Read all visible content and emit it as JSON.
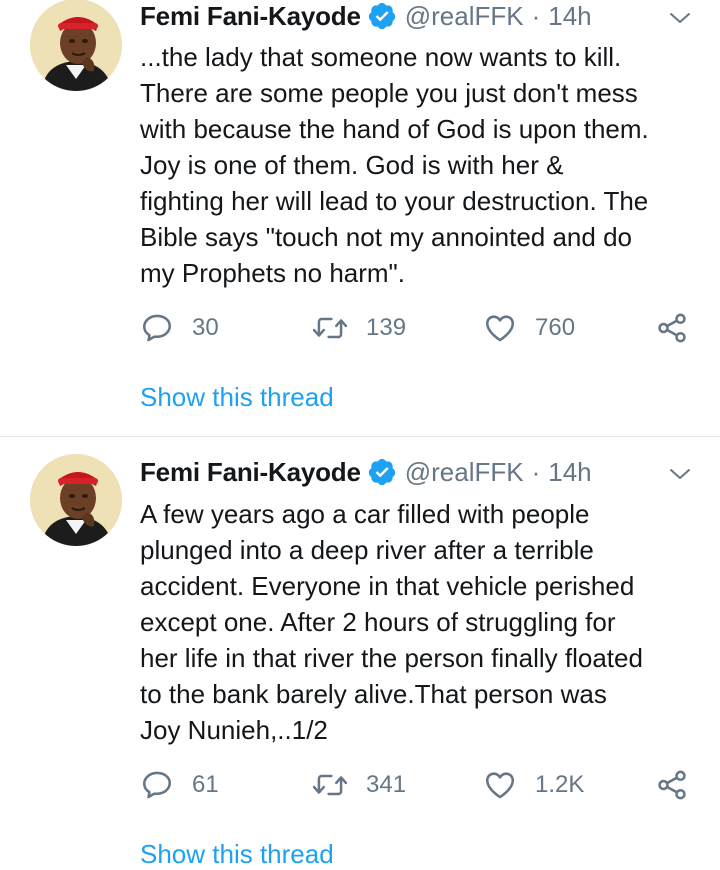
{
  "tweets": [
    {
      "author_name": "Femi Fani-Kayode",
      "handle": "@realFFK",
      "separator": "·",
      "time": "14h",
      "lines": [
        "...the lady that someone now wants to kill.",
        "There are some people you just don't mess",
        "with because the hand of God is upon them.",
        "Joy is one of them. God is with her &",
        "fighting her will lead to your destruction. The",
        "Bible says \"touch not my annointed and do",
        "my Prophets no harm\"."
      ],
      "replies": "30",
      "retweets": "139",
      "likes": "760",
      "show_thread": "Show this thread"
    },
    {
      "author_name": "Femi Fani-Kayode",
      "handle": "@realFFK",
      "separator": "·",
      "time": "14h",
      "lines": [
        "A few years ago a car filled with people",
        "plunged into a deep river after a terrible",
        "accident. Everyone in that vehicle perished",
        "except one. After 2 hours of struggling for",
        "her life in that river the person finally floated",
        "to the bank barely alive.That person was",
        "Joy Nunieh,..1/2"
      ],
      "replies": "61",
      "retweets": "341",
      "likes": "1.2K",
      "show_thread": "Show this thread"
    }
  ],
  "icons": {
    "verified": "verified-badge-icon",
    "more": "chevron-down-icon",
    "reply": "reply-icon",
    "retweet": "retweet-icon",
    "like": "heart-icon",
    "share": "share-icon"
  },
  "colors": {
    "accent": "#1da1f2",
    "text": "#14171a",
    "muted": "#657786",
    "divider": "#e1e8ed"
  }
}
